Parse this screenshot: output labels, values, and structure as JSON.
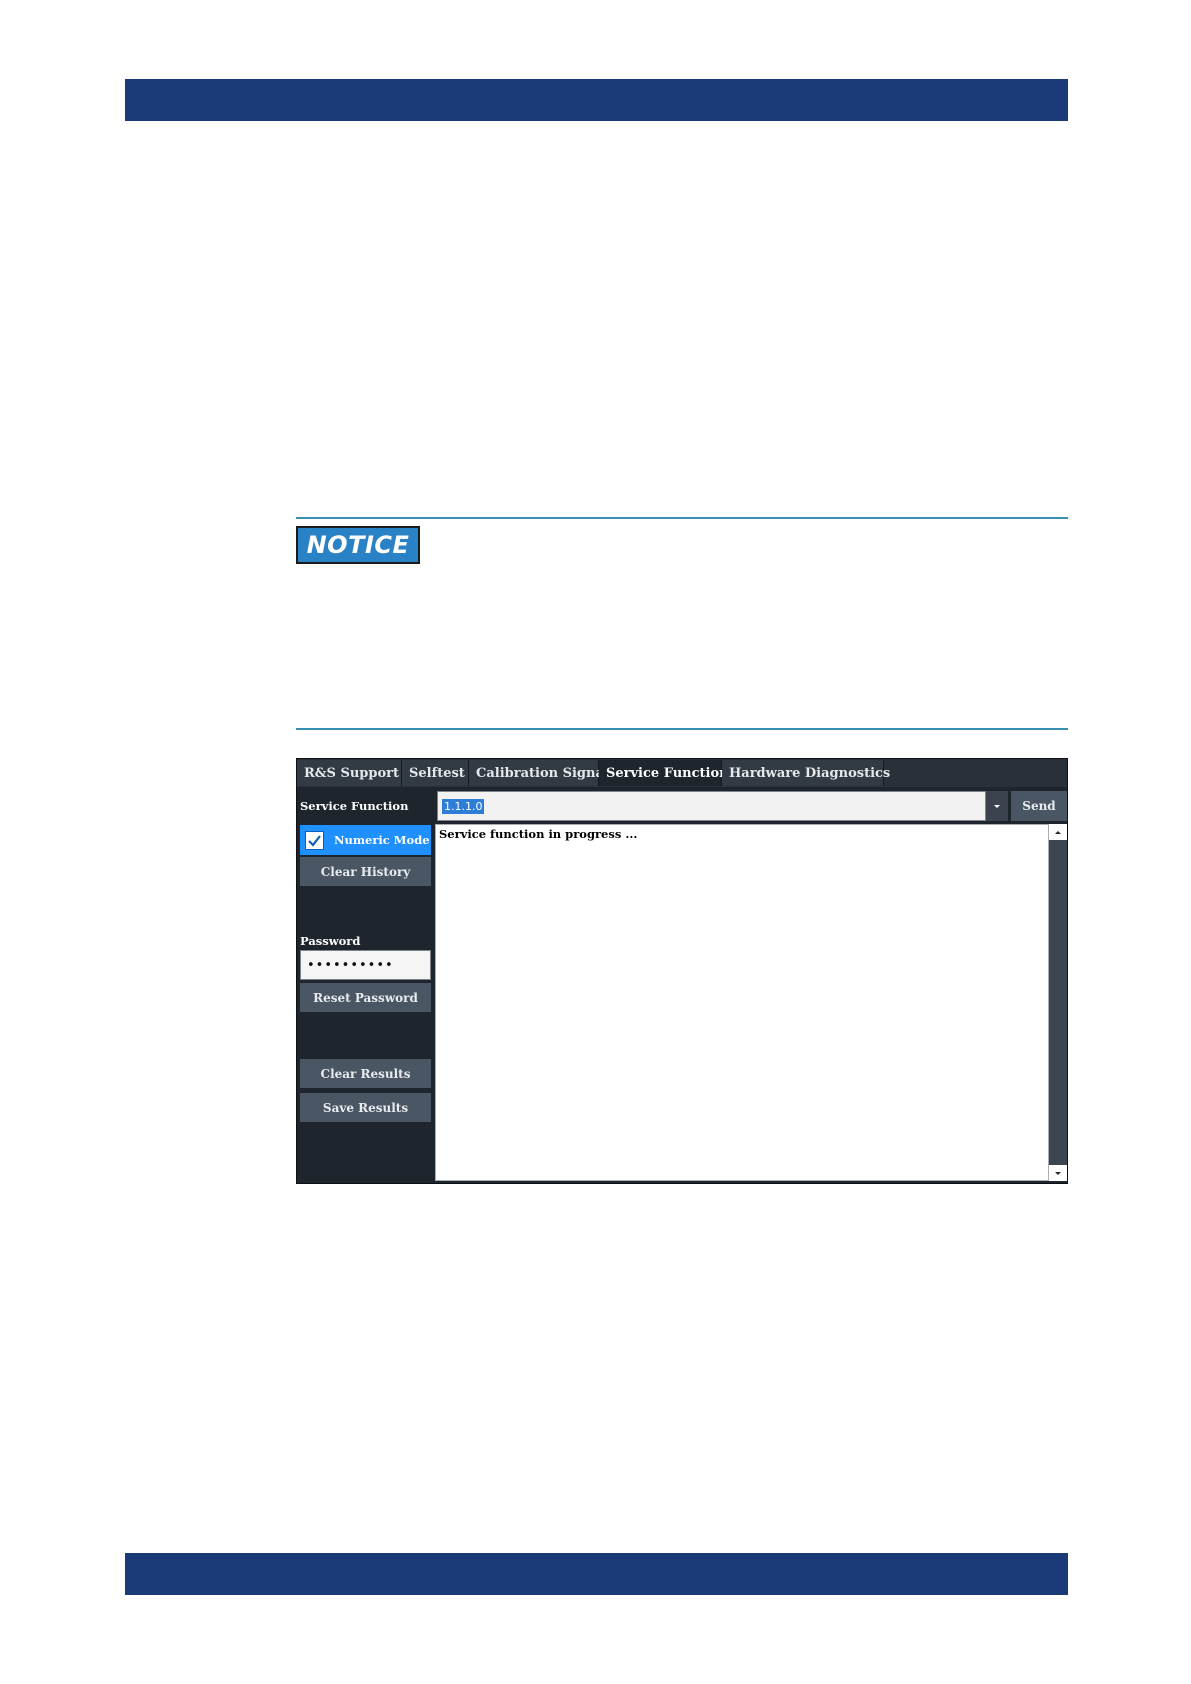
{
  "notice": {
    "label": "NOTICE"
  },
  "app": {
    "tabs": [
      {
        "label": "R&S Support"
      },
      {
        "label": "Selftest"
      },
      {
        "label": "Calibration Signal"
      },
      {
        "label": "Service Function",
        "active": true
      },
      {
        "label": "Hardware Diagnostics"
      }
    ],
    "service_function_label": "Service Function",
    "command_value": "1.1.1.0",
    "send_label": "Send",
    "numeric_mode_label": "Numeric Mode",
    "numeric_mode_checked": true,
    "clear_history_label": "Clear History",
    "password_label": "Password",
    "password_value": "••••••••••",
    "reset_password_label": "Reset Password",
    "clear_results_label": "Clear Results",
    "save_results_label": "Save Results",
    "output_text": "Service function in progress ..."
  },
  "colors": {
    "header_bar": "#1a3a78",
    "rule": "#3a8fb0",
    "notice_badge": "#2a82c6",
    "app_bg": "#1f252d",
    "button": "#4a5663",
    "accent": "#1e90ff",
    "selection": "#2e7ed8"
  },
  "icons": {
    "checkbox": "checkmark-icon",
    "dropdown": "chevron-down-icon",
    "scroll_up": "triangle-up-icon",
    "scroll_down": "triangle-down-icon"
  }
}
